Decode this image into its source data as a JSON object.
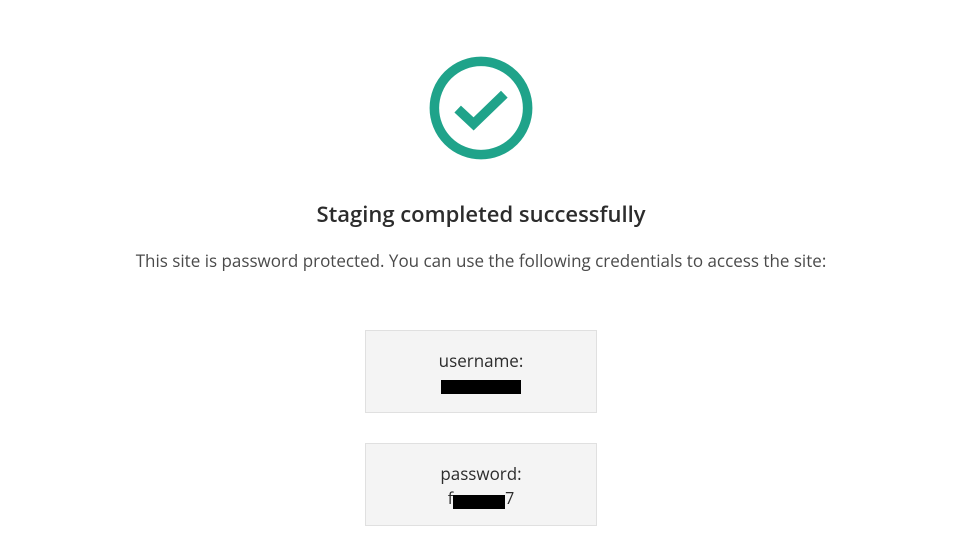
{
  "icon": {
    "name": "checkmark-circle-icon",
    "color": "#1fa38a"
  },
  "heading": "Staging completed successfully",
  "subtext": "This site is password protected. You can use the following credentials to access the site:",
  "credentials": {
    "username": {
      "label": "username:",
      "value_redacted": true,
      "visible_prefix": "",
      "visible_suffix": ""
    },
    "password": {
      "label": "password:",
      "value_redacted": true,
      "visible_prefix": "f",
      "visible_suffix": "7"
    }
  }
}
